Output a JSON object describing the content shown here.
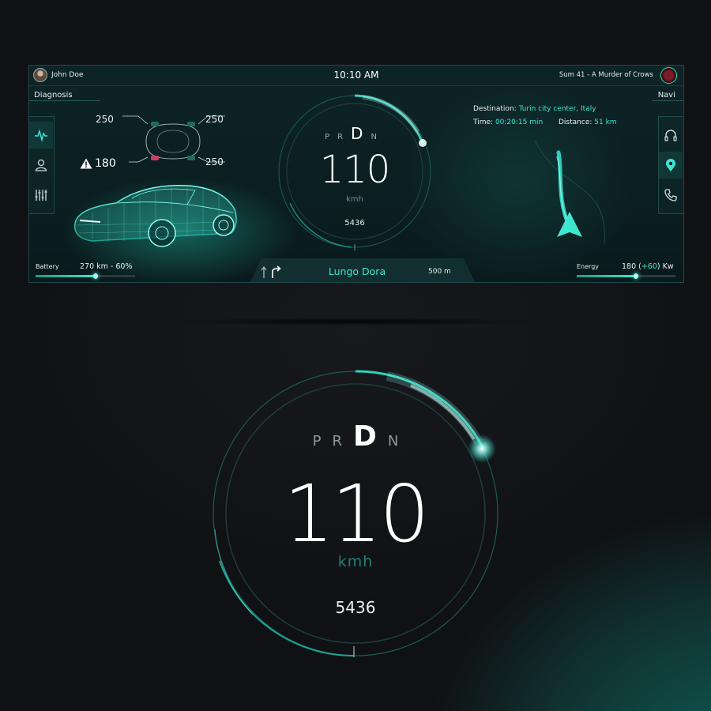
{
  "header": {
    "user_name": "John Doe",
    "time": "10:10 AM",
    "now_playing": "Sum 41 - A Murder of Crows"
  },
  "diagnosis": {
    "label": "Diagnosis",
    "tire_pressures": {
      "front_left": "250",
      "front_right": "250",
      "rear_left": "180",
      "rear_right": "250"
    }
  },
  "navi": {
    "label": "Navi",
    "destination_label": "Destination:",
    "destination_value": "Turin city center, Italy",
    "time_label": "Time:",
    "time_value": "00:20:15 min",
    "distance_label": "Distance:",
    "distance_value": "51 km"
  },
  "left_nav": [
    "pulse-icon",
    "user-icon",
    "sliders-icon"
  ],
  "right_nav": [
    "headphones-icon",
    "location-pin-icon",
    "phone-icon"
  ],
  "gauge": {
    "gears": [
      "P",
      "R",
      "D",
      "N"
    ],
    "selected_gear": "D",
    "speed": "110",
    "unit": "kmh",
    "odometer": "5436"
  },
  "navigation_bar": {
    "street": "Lungo Dora",
    "distance": "500 m"
  },
  "battery": {
    "label": "Battery",
    "value": "270 km - 60%",
    "level": 0.6
  },
  "energy": {
    "label": "Energy",
    "value_prefix": "180 (",
    "value_delta": "+60",
    "value_suffix": ") Kw",
    "level": 0.6
  },
  "colors": {
    "accent": "#3fe6cf",
    "background": "#101114",
    "warning": "#e0406a"
  }
}
